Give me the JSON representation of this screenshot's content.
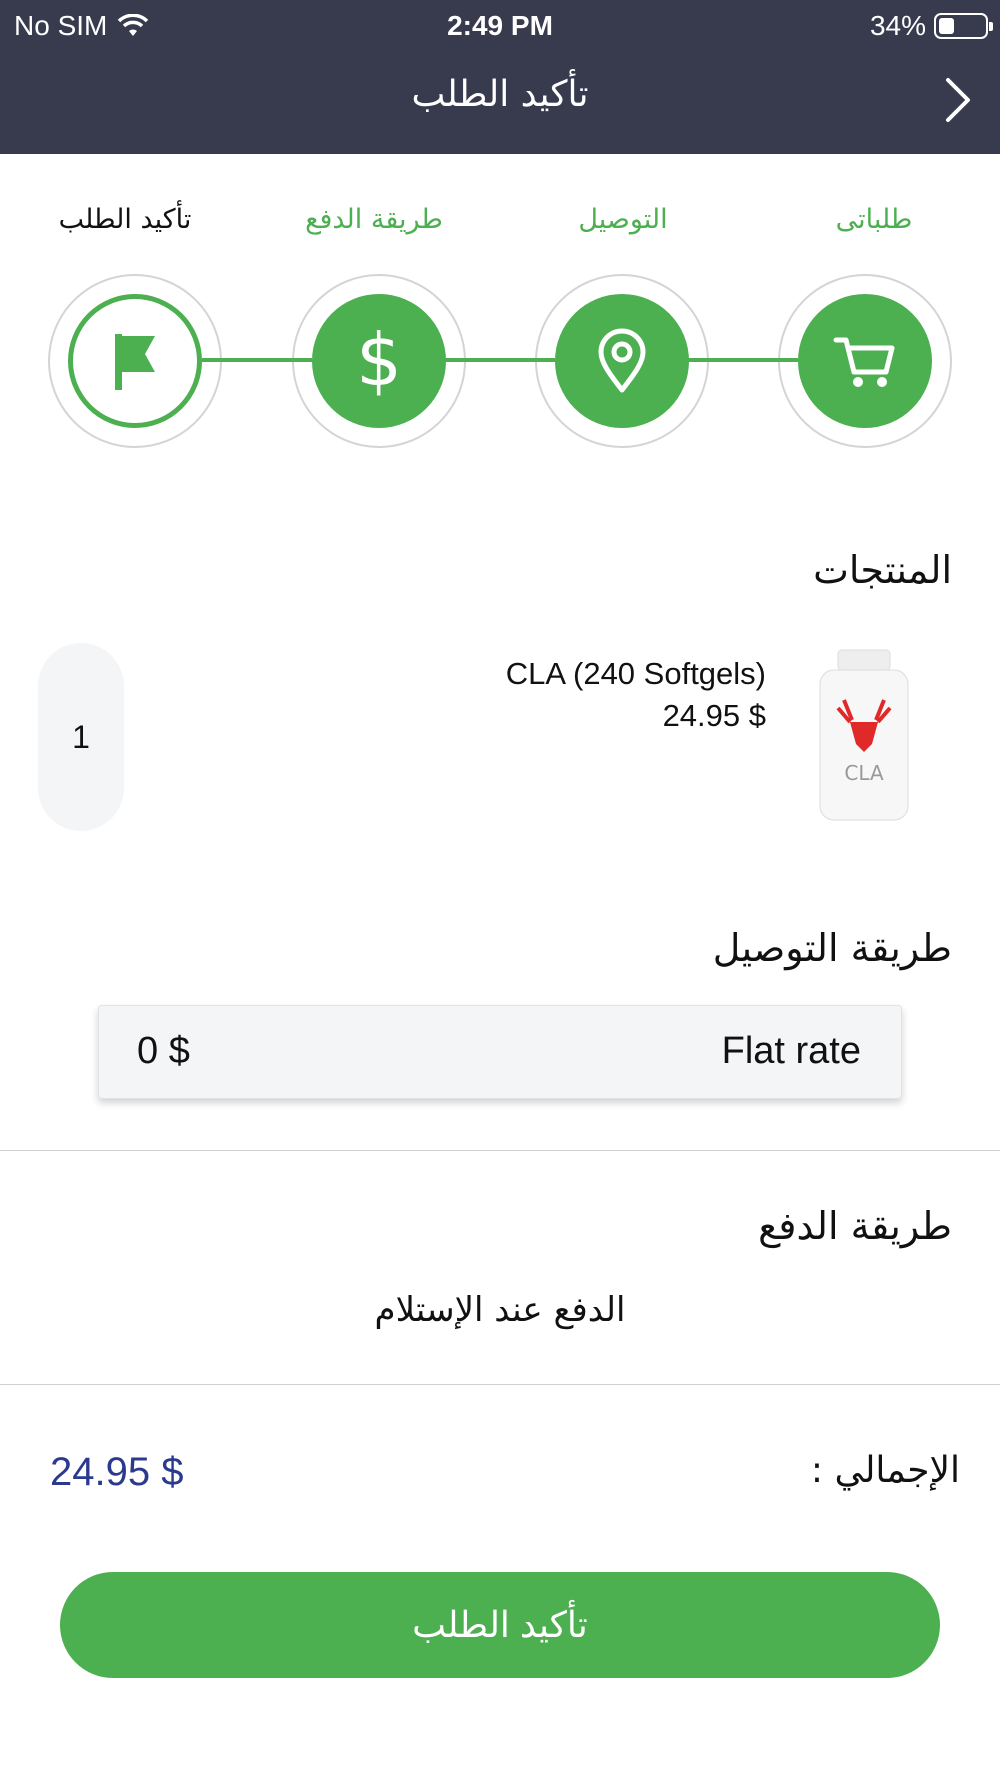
{
  "status_bar": {
    "carrier": "No SIM",
    "time": "2:49 PM",
    "battery_percent": "34%",
    "battery_level": 0.34
  },
  "nav": {
    "title": "تأكيد الطلب",
    "back_icon": "chevron-right-icon"
  },
  "steps": [
    {
      "label": "طلباتى",
      "icon": "cart-icon",
      "state": "done"
    },
    {
      "label": "التوصيل",
      "icon": "location-pin-icon",
      "state": "done"
    },
    {
      "label": "طريقة الدفع",
      "icon": "dollar-icon",
      "state": "done"
    },
    {
      "label": "تأكيد الطلب",
      "icon": "flag-icon",
      "state": "current"
    }
  ],
  "products": {
    "title": "المنتجات",
    "items": [
      {
        "name": "CLA (240 Softgels)",
        "price": "24.95 $",
        "quantity": "1",
        "image_label": "CLA"
      }
    ]
  },
  "shipping": {
    "title": "طريقة التوصيل",
    "method": "Flat rate",
    "price": "0 $"
  },
  "payment": {
    "title": "طريقة الدفع",
    "method": "الدفع عند الإستلام"
  },
  "total": {
    "label": "الإجمالي :",
    "value": "24.95 $"
  },
  "confirm_button": "تأكيد الطلب",
  "colors": {
    "header": "#383a4e",
    "accent_green": "#4caf50",
    "total_blue": "#2b3a8f"
  }
}
